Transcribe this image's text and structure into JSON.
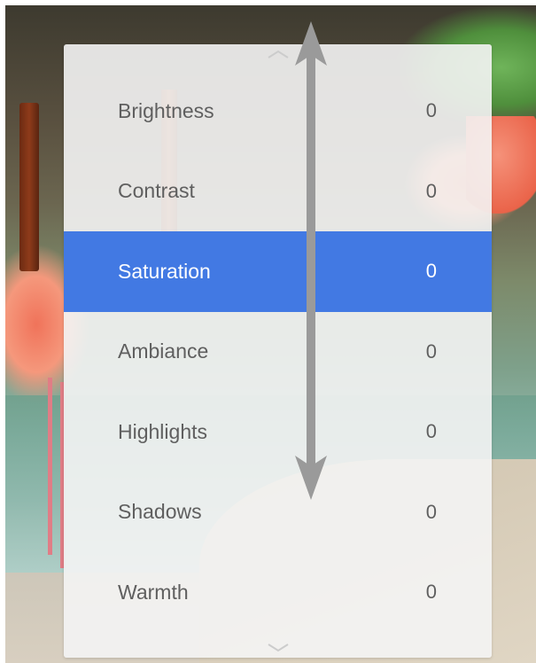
{
  "background": {
    "description_icon": "flamingo-photo"
  },
  "menu": {
    "scroll_up_icon": "chevron-up-icon",
    "scroll_down_icon": "chevron-down-icon",
    "selected_color": "#4279e3",
    "items": [
      {
        "label": "Brightness",
        "value": "0",
        "selected": false
      },
      {
        "label": "Contrast",
        "value": "0",
        "selected": false
      },
      {
        "label": "Saturation",
        "value": "0",
        "selected": true
      },
      {
        "label": "Ambiance",
        "value": "0",
        "selected": false
      },
      {
        "label": "Highlights",
        "value": "0",
        "selected": false
      },
      {
        "label": "Shadows",
        "value": "0",
        "selected": false
      },
      {
        "label": "Warmth",
        "value": "0",
        "selected": false
      }
    ]
  },
  "gesture": {
    "icon": "vertical-swipe-arrow-icon",
    "color": "#9a9a9a"
  }
}
